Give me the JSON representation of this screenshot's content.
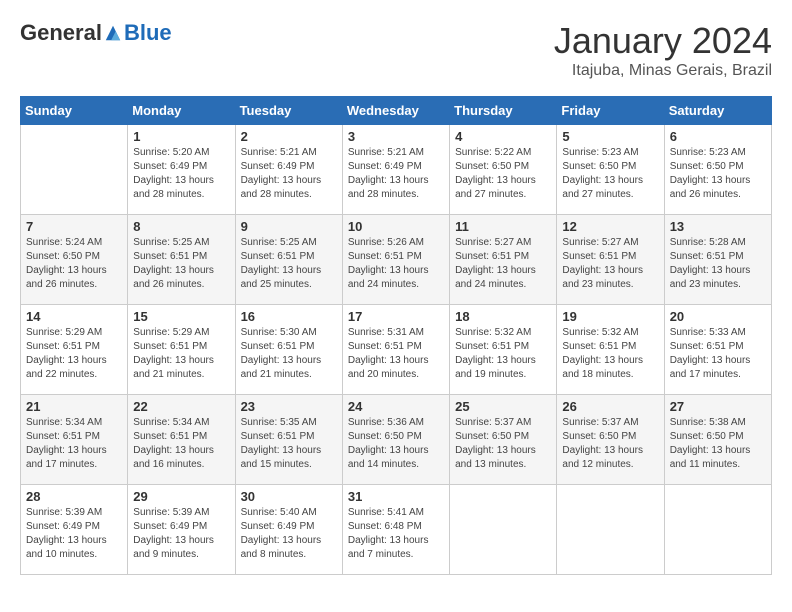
{
  "logo": {
    "general": "General",
    "blue": "Blue"
  },
  "title": {
    "month": "January 2024",
    "location": "Itajuba, Minas Gerais, Brazil"
  },
  "weekdays": [
    "Sunday",
    "Monday",
    "Tuesday",
    "Wednesday",
    "Thursday",
    "Friday",
    "Saturday"
  ],
  "weeks": [
    [
      {
        "day": "",
        "info": ""
      },
      {
        "day": "1",
        "info": "Sunrise: 5:20 AM\nSunset: 6:49 PM\nDaylight: 13 hours\nand 28 minutes."
      },
      {
        "day": "2",
        "info": "Sunrise: 5:21 AM\nSunset: 6:49 PM\nDaylight: 13 hours\nand 28 minutes."
      },
      {
        "day": "3",
        "info": "Sunrise: 5:21 AM\nSunset: 6:49 PM\nDaylight: 13 hours\nand 28 minutes."
      },
      {
        "day": "4",
        "info": "Sunrise: 5:22 AM\nSunset: 6:50 PM\nDaylight: 13 hours\nand 27 minutes."
      },
      {
        "day": "5",
        "info": "Sunrise: 5:23 AM\nSunset: 6:50 PM\nDaylight: 13 hours\nand 27 minutes."
      },
      {
        "day": "6",
        "info": "Sunrise: 5:23 AM\nSunset: 6:50 PM\nDaylight: 13 hours\nand 26 minutes."
      }
    ],
    [
      {
        "day": "7",
        "info": "Sunrise: 5:24 AM\nSunset: 6:50 PM\nDaylight: 13 hours\nand 26 minutes."
      },
      {
        "day": "8",
        "info": "Sunrise: 5:25 AM\nSunset: 6:51 PM\nDaylight: 13 hours\nand 26 minutes."
      },
      {
        "day": "9",
        "info": "Sunrise: 5:25 AM\nSunset: 6:51 PM\nDaylight: 13 hours\nand 25 minutes."
      },
      {
        "day": "10",
        "info": "Sunrise: 5:26 AM\nSunset: 6:51 PM\nDaylight: 13 hours\nand 24 minutes."
      },
      {
        "day": "11",
        "info": "Sunrise: 5:27 AM\nSunset: 6:51 PM\nDaylight: 13 hours\nand 24 minutes."
      },
      {
        "day": "12",
        "info": "Sunrise: 5:27 AM\nSunset: 6:51 PM\nDaylight: 13 hours\nand 23 minutes."
      },
      {
        "day": "13",
        "info": "Sunrise: 5:28 AM\nSunset: 6:51 PM\nDaylight: 13 hours\nand 23 minutes."
      }
    ],
    [
      {
        "day": "14",
        "info": "Sunrise: 5:29 AM\nSunset: 6:51 PM\nDaylight: 13 hours\nand 22 minutes."
      },
      {
        "day": "15",
        "info": "Sunrise: 5:29 AM\nSunset: 6:51 PM\nDaylight: 13 hours\nand 21 minutes."
      },
      {
        "day": "16",
        "info": "Sunrise: 5:30 AM\nSunset: 6:51 PM\nDaylight: 13 hours\nand 21 minutes."
      },
      {
        "day": "17",
        "info": "Sunrise: 5:31 AM\nSunset: 6:51 PM\nDaylight: 13 hours\nand 20 minutes."
      },
      {
        "day": "18",
        "info": "Sunrise: 5:32 AM\nSunset: 6:51 PM\nDaylight: 13 hours\nand 19 minutes."
      },
      {
        "day": "19",
        "info": "Sunrise: 5:32 AM\nSunset: 6:51 PM\nDaylight: 13 hours\nand 18 minutes."
      },
      {
        "day": "20",
        "info": "Sunrise: 5:33 AM\nSunset: 6:51 PM\nDaylight: 13 hours\nand 17 minutes."
      }
    ],
    [
      {
        "day": "21",
        "info": "Sunrise: 5:34 AM\nSunset: 6:51 PM\nDaylight: 13 hours\nand 17 minutes."
      },
      {
        "day": "22",
        "info": "Sunrise: 5:34 AM\nSunset: 6:51 PM\nDaylight: 13 hours\nand 16 minutes."
      },
      {
        "day": "23",
        "info": "Sunrise: 5:35 AM\nSunset: 6:51 PM\nDaylight: 13 hours\nand 15 minutes."
      },
      {
        "day": "24",
        "info": "Sunrise: 5:36 AM\nSunset: 6:50 PM\nDaylight: 13 hours\nand 14 minutes."
      },
      {
        "day": "25",
        "info": "Sunrise: 5:37 AM\nSunset: 6:50 PM\nDaylight: 13 hours\nand 13 minutes."
      },
      {
        "day": "26",
        "info": "Sunrise: 5:37 AM\nSunset: 6:50 PM\nDaylight: 13 hours\nand 12 minutes."
      },
      {
        "day": "27",
        "info": "Sunrise: 5:38 AM\nSunset: 6:50 PM\nDaylight: 13 hours\nand 11 minutes."
      }
    ],
    [
      {
        "day": "28",
        "info": "Sunrise: 5:39 AM\nSunset: 6:49 PM\nDaylight: 13 hours\nand 10 minutes."
      },
      {
        "day": "29",
        "info": "Sunrise: 5:39 AM\nSunset: 6:49 PM\nDaylight: 13 hours\nand 9 minutes."
      },
      {
        "day": "30",
        "info": "Sunrise: 5:40 AM\nSunset: 6:49 PM\nDaylight: 13 hours\nand 8 minutes."
      },
      {
        "day": "31",
        "info": "Sunrise: 5:41 AM\nSunset: 6:48 PM\nDaylight: 13 hours\nand 7 minutes."
      },
      {
        "day": "",
        "info": ""
      },
      {
        "day": "",
        "info": ""
      },
      {
        "day": "",
        "info": ""
      }
    ]
  ]
}
